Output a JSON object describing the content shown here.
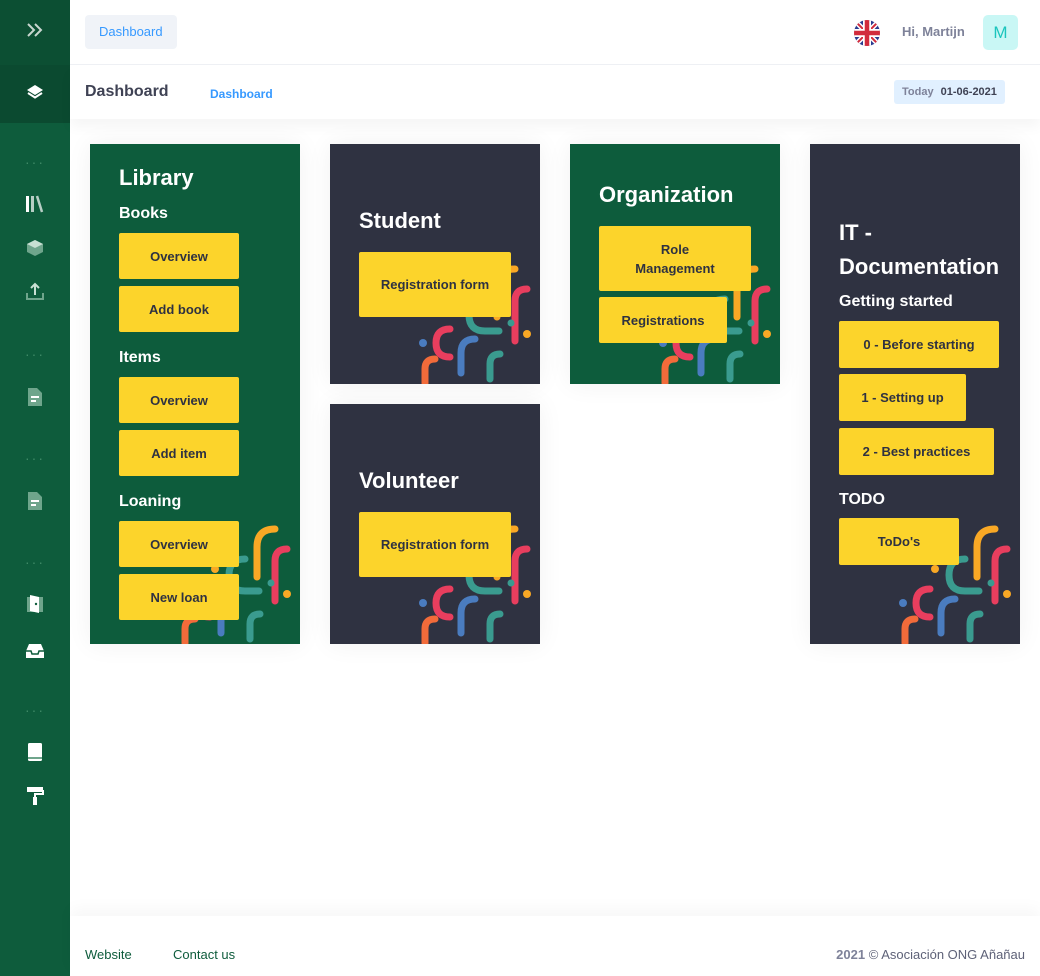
{
  "header": {
    "dashboard_button": "Dashboard",
    "greeting": "Hi, Martijn",
    "avatar_initial": "M",
    "language_flag": "uk-flag-icon"
  },
  "subheader": {
    "title": "Dashboard",
    "breadcrumb": "Dashboard",
    "today_label": "Today",
    "today_value": "01-06-2021"
  },
  "sidebar": {
    "icons": [
      "expand-icon",
      "layers-icon",
      "library-icon",
      "box-icon",
      "upload-icon",
      "document-icon",
      "document-icon",
      "door-icon",
      "inbox-icon",
      "book-icon",
      "paint-roller-icon"
    ]
  },
  "cards": {
    "library": {
      "title": "Library",
      "books": "Books",
      "books_overview": "Overview",
      "add_book": "Add book",
      "items": "Items",
      "items_overview": "Overview",
      "add_item": "Add item",
      "loaning": "Loaning",
      "loaning_overview": "Overview",
      "new_loan": "New loan"
    },
    "student": {
      "title": "Student",
      "registration": "Registration form"
    },
    "volunteer": {
      "title": "Volunteer",
      "registration": "Registration form"
    },
    "organization": {
      "title": "Organization",
      "role_management": "Role Management",
      "registrations": "Registrations"
    },
    "it": {
      "title": "IT - Documentation",
      "getting_started": "Getting started",
      "before_starting": "0 - Before starting",
      "setting_up": "1 - Setting up",
      "best_practices": "2 - Best practices",
      "todo": "TODO",
      "todos": "ToDo's"
    }
  },
  "footer": {
    "website": "Website",
    "contact": "Contact us",
    "year": "2021",
    "copyright": "©  Asociación ONG Añañau"
  },
  "colors": {
    "sidebar": "#0e5c3c",
    "card_green": "#0d5c3c",
    "card_dark": "#2f3241",
    "button_yellow": "#fcd42b",
    "accent_blue": "#3699ff"
  }
}
